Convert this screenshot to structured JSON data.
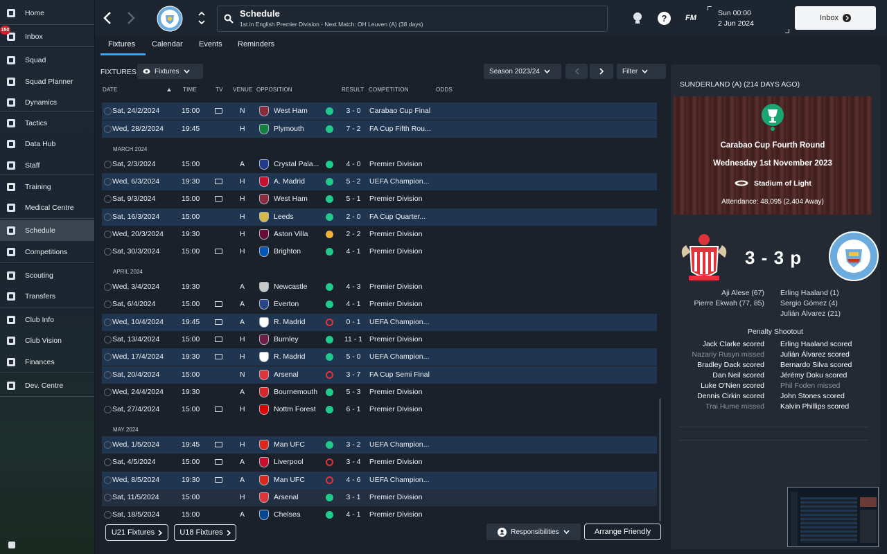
{
  "sidebar": {
    "items": [
      {
        "label": "Home",
        "icon": "home-icon"
      },
      {
        "label": "Inbox",
        "icon": "inbox-icon",
        "badge": "150"
      },
      {
        "label": "Squad",
        "icon": "shirt-icon"
      },
      {
        "label": "Squad Planner",
        "icon": "clipboard-icon"
      },
      {
        "label": "Dynamics",
        "icon": "dynamics-icon"
      },
      {
        "label": "Tactics",
        "icon": "tactics-icon"
      },
      {
        "label": "Data Hub",
        "icon": "data-hub-icon"
      },
      {
        "label": "Staff",
        "icon": "staff-icon"
      },
      {
        "label": "Training",
        "icon": "training-icon"
      },
      {
        "label": "Medical Centre",
        "icon": "medical-icon"
      },
      {
        "label": "Schedule",
        "icon": "calendar-icon"
      },
      {
        "label": "Competitions",
        "icon": "trophy-icon"
      },
      {
        "label": "Scouting",
        "icon": "magnifier-icon"
      },
      {
        "label": "Transfers",
        "icon": "transfer-icon"
      },
      {
        "label": "Club Info",
        "icon": "shield-icon"
      },
      {
        "label": "Club Vision",
        "icon": "briefcase-icon"
      },
      {
        "label": "Finances",
        "icon": "money-icon"
      },
      {
        "label": "Dev. Centre",
        "icon": "dev-centre-icon"
      }
    ]
  },
  "header": {
    "title": "Schedule",
    "subtitle": "1st in English Premier Division - Next Match: OH Leuven (A) (38 days)",
    "date_time": "Sun 00:00",
    "date": "2 Jun 2024",
    "inbox_label": "Inbox",
    "fm_label": "FM",
    "help_label": "?"
  },
  "tabs": [
    "Fixtures",
    "Calendar",
    "Events",
    "Reminders"
  ],
  "fixtures": {
    "title": "FIXTURES",
    "view_label": "Fixtures",
    "season_label": "Season 2023/24",
    "filter_label": "Filter",
    "columns": [
      "DATE",
      "TIME",
      "TV",
      "VENUE",
      "OPPOSITION",
      "RESULT",
      "COMPETITION",
      "ODDS"
    ],
    "months": [
      "MARCH 2024",
      "APRIL 2024",
      "MAY 2024"
    ],
    "rows": [
      {
        "date": "Sat, 24/2/2024",
        "time": "15:00",
        "tv": true,
        "venue": "N",
        "opp": "West Ham",
        "res": "w",
        "score": "3 - 0",
        "comp": "Carabao Cup Final"
      },
      {
        "date": "Wed, 28/2/2024",
        "time": "19:45",
        "tv": false,
        "venue": "H",
        "opp": "Plymouth",
        "res": "w",
        "score": "7 - 2",
        "comp": "FA Cup Fifth Rou..."
      },
      {
        "date": "Sat, 2/3/2024",
        "time": "15:00",
        "tv": false,
        "venue": "A",
        "opp": "Crystal Pala...",
        "res": "w",
        "score": "4 - 0",
        "comp": "Premier Division"
      },
      {
        "date": "Wed, 6/3/2024",
        "time": "19:30",
        "tv": true,
        "venue": "H",
        "opp": "A. Madrid",
        "res": "w",
        "score": "5 - 2",
        "comp": "UEFA Champion..."
      },
      {
        "date": "Sat, 9/3/2024",
        "time": "15:00",
        "tv": true,
        "venue": "H",
        "opp": "West Ham",
        "res": "w",
        "score": "5 - 1",
        "comp": "Premier Division"
      },
      {
        "date": "Sat, 16/3/2024",
        "time": "15:00",
        "tv": false,
        "venue": "H",
        "opp": "Leeds",
        "res": "w",
        "score": "2 - 0",
        "comp": "FA Cup Quarter..."
      },
      {
        "date": "Wed, 20/3/2024",
        "time": "19:30",
        "tv": false,
        "venue": "H",
        "opp": "Aston Villa",
        "res": "d",
        "score": "2 - 2",
        "comp": "Premier Division"
      },
      {
        "date": "Sat, 30/3/2024",
        "time": "15:00",
        "tv": true,
        "venue": "H",
        "opp": "Brighton",
        "res": "w",
        "score": "4 - 1",
        "comp": "Premier Division"
      },
      {
        "date": "Wed, 3/4/2024",
        "time": "19:30",
        "tv": false,
        "venue": "A",
        "opp": "Newcastle",
        "res": "w",
        "score": "4 - 3",
        "comp": "Premier Division"
      },
      {
        "date": "Sat, 6/4/2024",
        "time": "15:00",
        "tv": true,
        "venue": "A",
        "opp": "Everton",
        "res": "w",
        "score": "4 - 1",
        "comp": "Premier Division"
      },
      {
        "date": "Wed, 10/4/2024",
        "time": "19:45",
        "tv": true,
        "venue": "A",
        "opp": "R. Madrid",
        "res": "l",
        "score": "0 - 1",
        "comp": "UEFA Champion..."
      },
      {
        "date": "Sat, 13/4/2024",
        "time": "15:00",
        "tv": true,
        "venue": "H",
        "opp": "Burnley",
        "res": "w",
        "score": "11 - 1",
        "comp": "Premier Division"
      },
      {
        "date": "Wed, 17/4/2024",
        "time": "19:30",
        "tv": true,
        "venue": "H",
        "opp": "R. Madrid",
        "res": "w",
        "score": "5 - 0",
        "comp": "UEFA Champion..."
      },
      {
        "date": "Sat, 20/4/2024",
        "time": "15:00",
        "tv": false,
        "venue": "N",
        "opp": "Arsenal",
        "res": "l",
        "score": "3 - 7",
        "comp": "FA Cup Semi Final"
      },
      {
        "date": "Wed, 24/4/2024",
        "time": "19:30",
        "tv": false,
        "venue": "A",
        "opp": "Bournemouth",
        "res": "w",
        "score": "5 - 3",
        "comp": "Premier Division"
      },
      {
        "date": "Sat, 27/4/2024",
        "time": "15:00",
        "tv": true,
        "venue": "H",
        "opp": "Nottm Forest",
        "res": "w",
        "score": "6 - 1",
        "comp": "Premier Division"
      },
      {
        "date": "Wed, 1/5/2024",
        "time": "19:45",
        "tv": true,
        "venue": "H",
        "opp": "Man UFC",
        "res": "w",
        "score": "3 - 2",
        "comp": "UEFA Champion..."
      },
      {
        "date": "Sat, 4/5/2024",
        "time": "15:00",
        "tv": true,
        "venue": "A",
        "opp": "Liverpool",
        "res": "l",
        "score": "3 - 4",
        "comp": "Premier Division"
      },
      {
        "date": "Wed, 8/5/2024",
        "time": "19:30",
        "tv": true,
        "venue": "A",
        "opp": "Man UFC",
        "res": "l",
        "score": "4 - 6",
        "comp": "UEFA Champion..."
      },
      {
        "date": "Sat, 11/5/2024",
        "time": "15:00",
        "tv": false,
        "venue": "H",
        "opp": "Arsenal",
        "res": "w",
        "score": "3 - 1",
        "comp": "Premier Division"
      },
      {
        "date": "Sat, 18/5/2024",
        "time": "15:00",
        "tv": false,
        "venue": "A",
        "opp": "Chelsea",
        "res": "w",
        "score": "4 - 1",
        "comp": "Premier Division"
      }
    ],
    "u21_label": "U21 Fixtures",
    "u18_label": "U18 Fixtures",
    "responsibilities_label": "Responsibilities",
    "arrange_label": "Arrange Friendly"
  },
  "match": {
    "heading": "SUNDERLAND (A) (214 DAYS AGO)",
    "competition": "Carabao Cup Fourth Round",
    "date": "Wednesday 1st November 2023",
    "stadium": "Stadium of Light",
    "attendance": "Attendance: 48,095 (2,404 Away)",
    "score": "3 - 3 p",
    "home_scorers": [
      "Aji Alese (67)",
      "Pierre Ekwah (77, 85)"
    ],
    "away_scorers": [
      "Erling Haaland (1)",
      "Sergio Gómez (4)",
      "Julián Álvarez (21)"
    ],
    "shootout_title": "Penalty Shootout",
    "home_pens": [
      {
        "text": "Jack Clarke scored",
        "missed": false
      },
      {
        "text": "Nazariy Rusyn missed",
        "missed": true
      },
      {
        "text": "Bradley Dack scored",
        "missed": false
      },
      {
        "text": "Dan Neil scored",
        "missed": false
      },
      {
        "text": "Luke O'Nien scored",
        "missed": false
      },
      {
        "text": "Dennis Cirkin scored",
        "missed": false
      },
      {
        "text": "Trai Hume missed",
        "missed": true
      }
    ],
    "away_pens": [
      {
        "text": "Erling Haaland scored",
        "missed": false
      },
      {
        "text": "Julián Álvarez scored",
        "missed": false
      },
      {
        "text": "Bernardo Silva scored",
        "missed": false
      },
      {
        "text": "Jérémy Doku scored",
        "missed": false
      },
      {
        "text": "Phil Foden missed",
        "missed": true
      },
      {
        "text": "John Stones scored",
        "missed": false
      },
      {
        "text": "Kalvin Phillips scored",
        "missed": false
      }
    ]
  },
  "colors": {
    "accent": "#3aa3ff",
    "win": "#22c98a",
    "draw": "#f0b33a",
    "loss": "#e0343d",
    "highlight": "#1f3550"
  }
}
